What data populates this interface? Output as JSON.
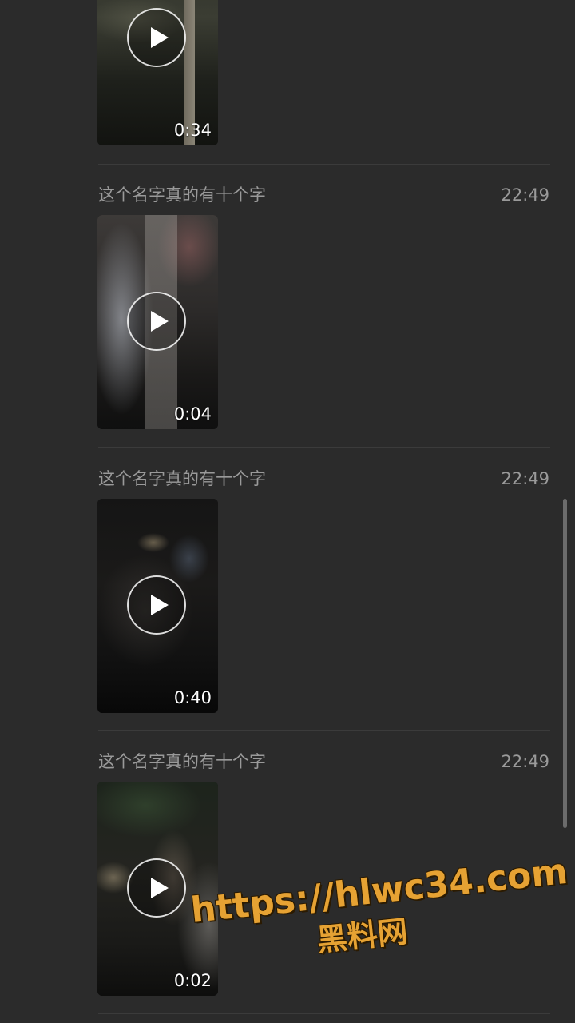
{
  "theme": {
    "background": "#2b2b2b",
    "secondary_text": "#9a9a9a",
    "divider": "#3b3b3b",
    "watermark_color": "#e6a233"
  },
  "messages": [
    {
      "sender": "",
      "time": "",
      "duration": "0:34",
      "play_icon": "play-icon"
    },
    {
      "sender": "这个名字真的有十个字",
      "time": "22:49",
      "duration": "0:04",
      "play_icon": "play-icon"
    },
    {
      "sender": "这个名字真的有十个字",
      "time": "22:49",
      "duration": "0:40",
      "play_icon": "play-icon"
    },
    {
      "sender": "这个名字真的有十个字",
      "time": "22:49",
      "duration": "0:02",
      "play_icon": "play-icon"
    }
  ],
  "watermark": {
    "url": "https://hlwc34.com",
    "name": "黑料网"
  }
}
